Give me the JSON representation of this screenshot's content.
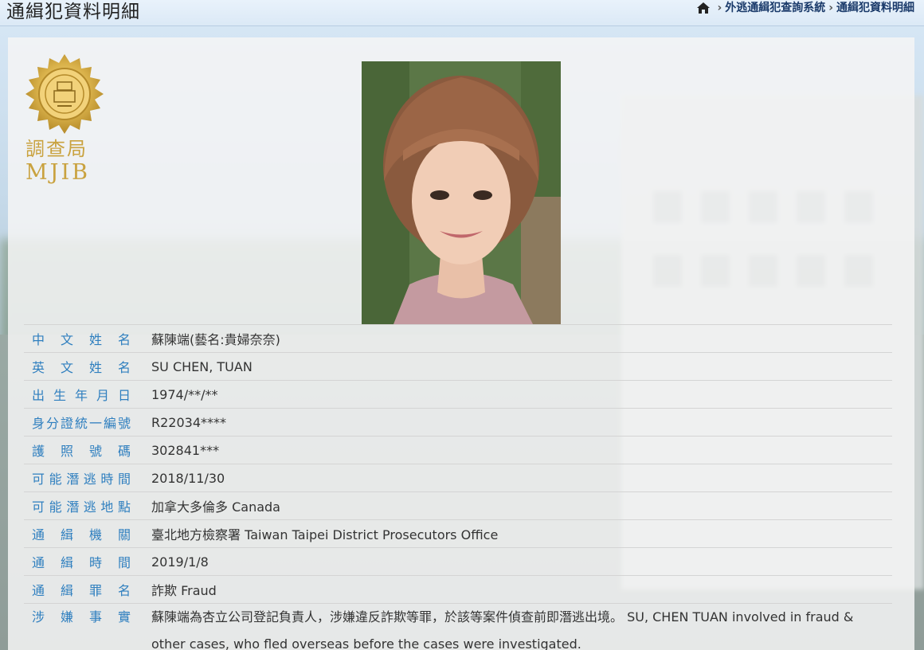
{
  "header": {
    "title": "通緝犯資料明細",
    "breadcrumb": [
      {
        "label": "外逃通緝犯查詢系統"
      },
      {
        "label": "通緝犯資料明細"
      }
    ]
  },
  "logo": {
    "chinese": "調查局",
    "english": "MJIB"
  },
  "record": {
    "rows": [
      {
        "label": "中文姓名",
        "value": "蘇陳端(藝名:貴婦奈奈)"
      },
      {
        "label": "英文姓名",
        "value": "SU CHEN, TUAN"
      },
      {
        "label": "出生年月日",
        "value": "1974/**/**"
      },
      {
        "label": "身分證統一編號",
        "value": "R22034****"
      },
      {
        "label": "護照號碼",
        "value": "302841***"
      },
      {
        "label": "可能潛逃時間",
        "value": "2018/11/30"
      },
      {
        "label": "可能潛逃地點",
        "value": "加拿大多倫多 Canada"
      },
      {
        "label": "通緝機關",
        "value": "臺北地方檢察署 Taiwan Taipei District Prosecutors Office"
      },
      {
        "label": "通緝時間",
        "value": "2019/1/8"
      },
      {
        "label": "通緝罪名",
        "value": "詐欺 Fraud"
      },
      {
        "label": "涉嫌事實",
        "value": "蘇陳端為杏立公司登記負責人，涉嫌違反詐欺等罪，於該等案件偵查前即潛逃出境。 SU, CHEN TUAN involved in fraud & other cases, who fled overseas before the cases were investigated."
      }
    ]
  },
  "colors": {
    "label": "#2f7fbf",
    "logo_gold": "#c9a23f"
  }
}
